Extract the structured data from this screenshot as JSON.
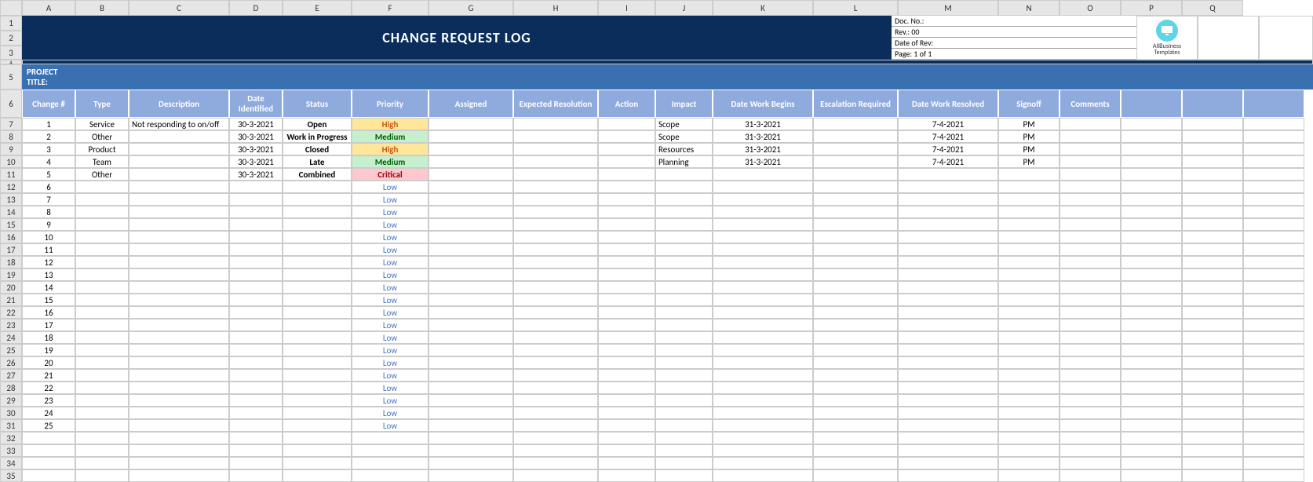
{
  "col_letters": [
    "A",
    "B",
    "C",
    "D",
    "E",
    "F",
    "G",
    "H",
    "I",
    "J",
    "K",
    "L",
    "M",
    "N",
    "O",
    "P",
    "Q"
  ],
  "row_numbers": [
    "1",
    "2",
    "3",
    "4",
    "5",
    "6",
    "7",
    "8",
    "9",
    "10",
    "11",
    "12",
    "13",
    "14",
    "15",
    "16",
    "17",
    "18",
    "19",
    "20",
    "21",
    "22",
    "23",
    "24",
    "25",
    "26",
    "27",
    "28",
    "29",
    "30",
    "31",
    "32",
    "33",
    "34",
    "35"
  ],
  "title": "CHANGE REQUEST LOG",
  "meta": {
    "doc_no": "Doc. No.:",
    "rev": "Rev.: 00",
    "date_rev": "Date of Rev:",
    "page": "Page: 1 of 1"
  },
  "brand": {
    "line1": "AllBusiness",
    "line2": "Templates"
  },
  "project": {
    "line1": "PROJECT",
    "line2": "TITLE:"
  },
  "headers": [
    "Change #",
    "Type",
    "Description",
    "Date Identified",
    "Status",
    "Priority",
    "Assigned",
    "Expected Resolution",
    "Action",
    "Impact",
    "Date Work Begins",
    "Escalation Required",
    "Date Work Resolved",
    "Signoff",
    "Comments"
  ],
  "rows": [
    {
      "n": "1",
      "type": "Service",
      "desc": "Not responding to on/off",
      "date_id": "30-3-2021",
      "status": "Open",
      "priority": "High",
      "pclass": "p-high",
      "impact": "Scope",
      "work_begins": "31-3-2021",
      "resolved": "7-4-2021",
      "signoff": "PM"
    },
    {
      "n": "2",
      "type": "Other",
      "desc": "",
      "date_id": "30-3-2021",
      "status": "Work in Progress",
      "priority": "Medium",
      "pclass": "p-medium",
      "impact": "Scope",
      "work_begins": "31-3-2021",
      "resolved": "7-4-2021",
      "signoff": "PM"
    },
    {
      "n": "3",
      "type": "Product",
      "desc": "",
      "date_id": "30-3-2021",
      "status": "Closed",
      "priority": "High",
      "pclass": "p-high",
      "impact": "Resources",
      "work_begins": "31-3-2021",
      "resolved": "7-4-2021",
      "signoff": "PM"
    },
    {
      "n": "4",
      "type": "Team",
      "desc": "",
      "date_id": "30-3-2021",
      "status": "Late",
      "priority": "Medium",
      "pclass": "p-medium",
      "impact": "Planning",
      "work_begins": "31-3-2021",
      "resolved": "7-4-2021",
      "signoff": "PM"
    },
    {
      "n": "5",
      "type": "Other",
      "desc": "",
      "date_id": "30-3-2021",
      "status": "Combined",
      "priority": "Critical",
      "pclass": "p-critical",
      "impact": "",
      "work_begins": "",
      "resolved": "",
      "signoff": ""
    },
    {
      "n": "6",
      "priority": "Low",
      "pclass": "p-low"
    },
    {
      "n": "7",
      "priority": "Low",
      "pclass": "p-low"
    },
    {
      "n": "8",
      "priority": "Low",
      "pclass": "p-low"
    },
    {
      "n": "9",
      "priority": "Low",
      "pclass": "p-low"
    },
    {
      "n": "10",
      "priority": "Low",
      "pclass": "p-low"
    },
    {
      "n": "11",
      "priority": "Low",
      "pclass": "p-low"
    },
    {
      "n": "12",
      "priority": "Low",
      "pclass": "p-low"
    },
    {
      "n": "13",
      "priority": "Low",
      "pclass": "p-low"
    },
    {
      "n": "14",
      "priority": "Low",
      "pclass": "p-low"
    },
    {
      "n": "15",
      "priority": "Low",
      "pclass": "p-low"
    },
    {
      "n": "16",
      "priority": "Low",
      "pclass": "p-low"
    },
    {
      "n": "17",
      "priority": "Low",
      "pclass": "p-low"
    },
    {
      "n": "18",
      "priority": "Low",
      "pclass": "p-low"
    },
    {
      "n": "19",
      "priority": "Low",
      "pclass": "p-low"
    },
    {
      "n": "20",
      "priority": "Low",
      "pclass": "p-low"
    },
    {
      "n": "21",
      "priority": "Low",
      "pclass": "p-low"
    },
    {
      "n": "22",
      "priority": "Low",
      "pclass": "p-low"
    },
    {
      "n": "23",
      "priority": "Low",
      "pclass": "p-low"
    },
    {
      "n": "24",
      "priority": "Low",
      "pclass": "p-low"
    },
    {
      "n": "25",
      "priority": "Low",
      "pclass": "p-low"
    }
  ],
  "empty_trailing_rows": 4,
  "row_heights": {
    "title_span": 3,
    "project_span": 1,
    "header_span": 1
  }
}
